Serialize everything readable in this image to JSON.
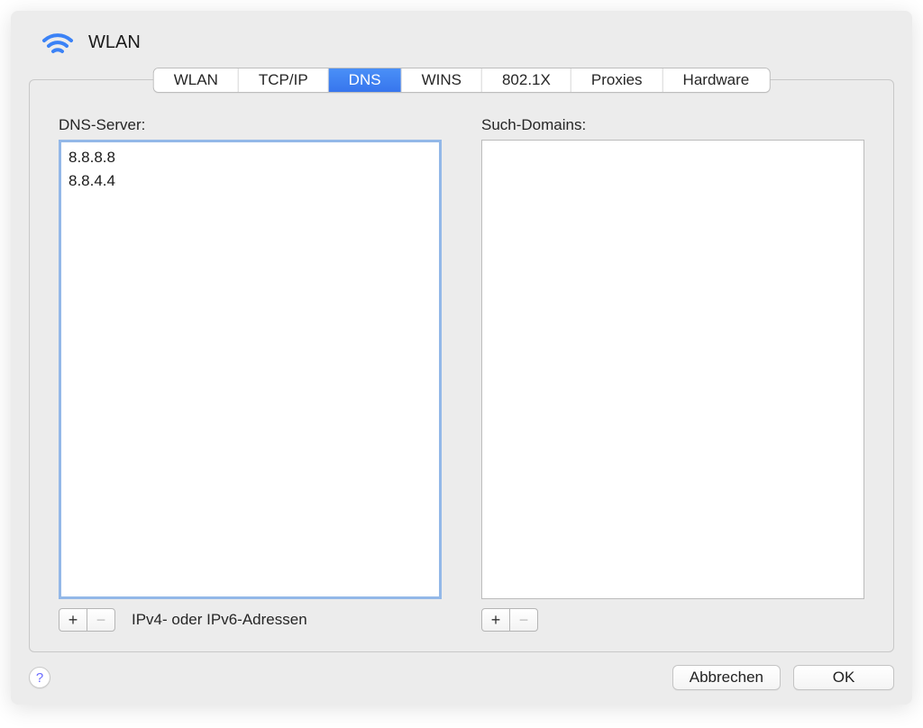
{
  "header": {
    "title": "WLAN"
  },
  "tabs": [
    {
      "label": "WLAN",
      "active": false
    },
    {
      "label": "TCP/IP",
      "active": false
    },
    {
      "label": "DNS",
      "active": true
    },
    {
      "label": "WINS",
      "active": false
    },
    {
      "label": "802.1X",
      "active": false
    },
    {
      "label": "Proxies",
      "active": false
    },
    {
      "label": "Hardware",
      "active": false
    }
  ],
  "dns": {
    "label": "DNS-Server:",
    "servers": [
      "8.8.8.8",
      "8.8.4.4"
    ],
    "hint": "IPv4- oder IPv6-Adressen"
  },
  "search": {
    "label": "Such-Domains:",
    "domains": []
  },
  "icons": {
    "plus": "+",
    "minus": "−",
    "help": "?"
  },
  "footer": {
    "cancel": "Abbrechen",
    "ok": "OK"
  }
}
